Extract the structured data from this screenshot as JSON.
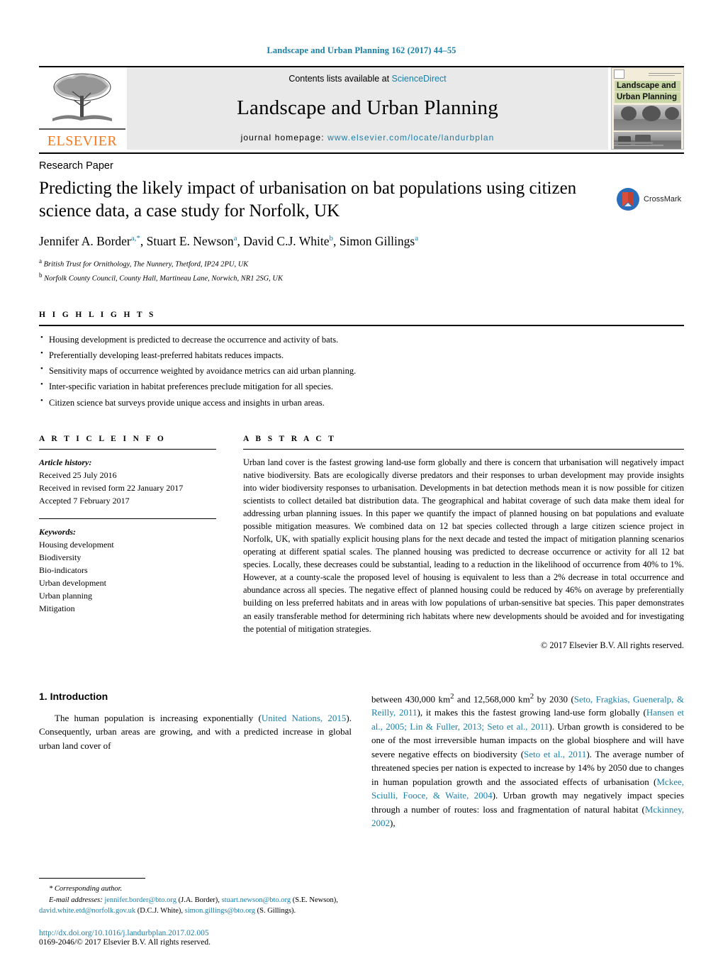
{
  "running_head": "Landscape and Urban Planning 162 (2017) 44–55",
  "masthead": {
    "publisher": "ELSEVIER",
    "contents_prefix": "Contents lists available at ",
    "contents_link": "ScienceDirect",
    "journal_title": "Landscape and Urban Planning",
    "homepage_prefix": "journal homepage: ",
    "homepage_url": "www.elsevier.com/locate/landurbplan",
    "cover_title_line1": "Landscape and",
    "cover_title_line2": "Urban Planning"
  },
  "article": {
    "type": "Research Paper",
    "title": "Predicting the likely impact of urbanisation on bat populations using citizen science data, a case study for Norfolk, UK",
    "crossmark_label": "CrossMark",
    "authors_html": "Jennifer A. Border<sup>a,*</sup>, Stuart E. Newson<sup>a</sup>, David C.J. White<sup>b</sup>, Simon Gillings<sup>a</sup>",
    "affiliation_a": "British Trust for Ornithology, The Nunnery, Thetford, IP24 2PU, UK",
    "affiliation_b": "Norfolk County Council, County Hall, Martineau Lane, Norwich, NR1 2SG, UK"
  },
  "highlights": {
    "label": "H I G H L I G H T S",
    "items": [
      "Housing development is predicted to decrease the occurrence and activity of bats.",
      "Preferentially developing least-preferred habitats reduces impacts.",
      "Sensitivity maps of occurrence weighted by avoidance metrics can aid urban planning.",
      "Inter-specific variation in habitat preferences preclude mitigation for all species.",
      "Citizen science bat surveys provide unique access and insights in urban areas."
    ]
  },
  "article_info": {
    "label": "A R T I C L E   I N F O",
    "history_label": "Article history:",
    "history": [
      "Received 25 July 2016",
      "Received in revised form 22 January 2017",
      "Accepted 7 February 2017"
    ],
    "keywords_label": "Keywords:",
    "keywords": [
      "Housing development",
      "Biodiversity",
      "Bio-indicators",
      "Urban development",
      "Urban planning",
      "Mitigation"
    ]
  },
  "abstract": {
    "label": "A B S T R A C T",
    "text": "Urban land cover is the fastest growing land-use form globally and there is concern that urbanisation will negatively impact native biodiversity. Bats are ecologically diverse predators and their responses to urban development may provide insights into wider biodiversity responses to urbanisation. Developments in bat detection methods mean it is now possible for citizen scientists to collect detailed bat distribution data. The geographical and habitat coverage of such data make them ideal for addressing urban planning issues. In this paper we quantify the impact of planned housing on bat populations and evaluate possible mitigation measures. We combined data on 12 bat species collected through a large citizen science project in Norfolk, UK, with spatially explicit housing plans for the next decade and tested the impact of mitigation planning scenarios operating at different spatial scales. The planned housing was predicted to decrease occurrence or activity for all 12 bat species. Locally, these decreases could be substantial, leading to a reduction in the likelihood of occurrence from 40% to 1%. However, at a county-scale the proposed level of housing is equivalent to less than a 2% decrease in total occurrence and abundance across all species. The negative effect of planned housing could be reduced by 46% on average by preferentially building on less preferred habitats and in areas with low populations of urban-sensitive bat species. This paper demonstrates an easily transferable method for determining rich habitats where new developments should be avoided and for investigating the potential of mitigation strategies.",
    "copyright": "© 2017 Elsevier B.V. All rights reserved."
  },
  "introduction": {
    "heading": "1.  Introduction",
    "left_paragraph_html": "The human population is increasing exponentially (<span class=\"ref\">United Nations, 2015</span>). Consequently, urban areas are growing, and with a predicted increase in global urban land cover of",
    "right_paragraph_html": "between 430,000 km<sup>2</sup> and 12,568,000 km<sup>2</sup> by 2030 (<span class=\"ref\">Seto, Fragkias, Gueneralp, &amp; Reilly, 2011</span>), it makes this the fastest growing land-use form globally (<span class=\"ref\">Hansen et al., 2005; Lin &amp; Fuller, 2013; Seto et al., 2011</span>). Urban growth is considered to be one of the most irreversible human impacts on the global biosphere and will have severe negative effects on biodiversity (<span class=\"ref\">Seto et al., 2011</span>). The average number of threatened species per nation is expected to increase by 14% by 2050 due to changes in human population growth and the associated effects of urbanisation (<span class=\"ref\">Mckee, Sciulli, Fooce, &amp; Waite, 2004</span>). Urban growth may negatively impact species through a number of routes: loss and fragmentation of natural habitat (<span class=\"ref\">Mckinney, 2002</span>),"
  },
  "footnotes": {
    "corresponding_html": "<span class=\"it\">*  Corresponding author.</span>",
    "emails_html": "<span class=\"it\">E-mail addresses:</span> <span class=\"ref\">jennifer.border@bto.org</span> (J.A. Border), <span class=\"ref\">stuart.newson@bto.org</span> (S.E. Newson), <span class=\"ref\">david.white.etd@norfolk.gov.uk</span> (D.C.J. White), <span class=\"ref\">simon.gillings@bto.org</span> (S. Gillings)."
  },
  "footer": {
    "doi": "http://dx.doi.org/10.1016/j.landurbplan.2017.02.005",
    "issn_html": "0169-2046/© 2017 Elsevier B.V. All rights reserved."
  },
  "colors": {
    "link_blue": "#1a7fa8",
    "elsevier_orange": "#F47920",
    "masthead_gray": "#e9e9e9",
    "cover_green": "#c9d6a6"
  }
}
